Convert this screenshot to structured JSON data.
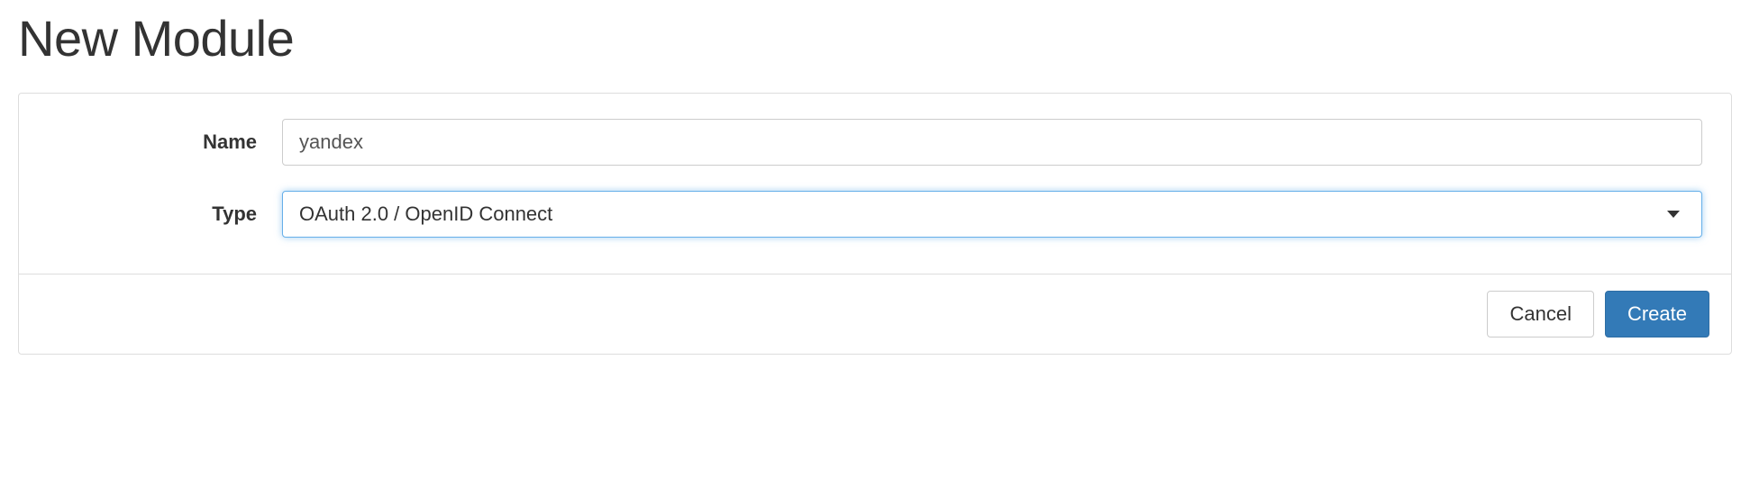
{
  "page": {
    "title": "New Module"
  },
  "form": {
    "name": {
      "label": "Name",
      "value": "yandex"
    },
    "type": {
      "label": "Type",
      "selected": "OAuth 2.0 / OpenID Connect"
    }
  },
  "footer": {
    "cancel_label": "Cancel",
    "create_label": "Create"
  }
}
